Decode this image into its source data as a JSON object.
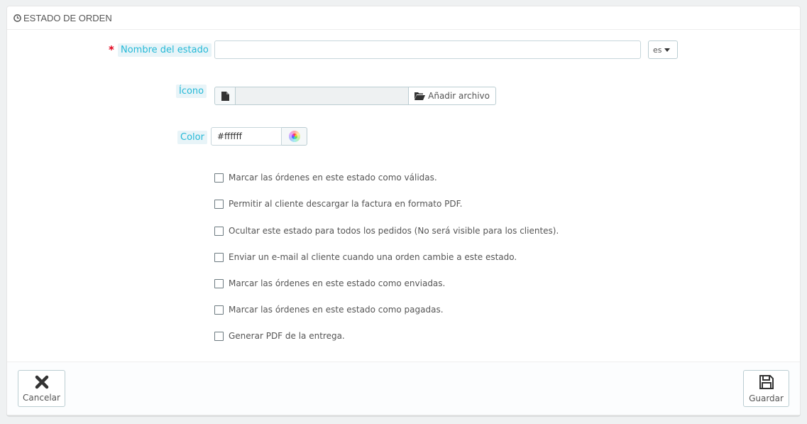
{
  "panel": {
    "title": "ESTADO DE ORDEN",
    "title_icon": "clock-icon"
  },
  "form": {
    "name_field": {
      "label": "Nombre del estado",
      "required": true,
      "value": "",
      "language": "es"
    },
    "icon_field": {
      "label": "Ícono",
      "file_icon": "file-icon",
      "button_label": "Añadir archivo",
      "button_icon": "folder-open-icon"
    },
    "color_field": {
      "label": "Color",
      "value": "#ffffff",
      "picker_icon": "color-wheel-icon"
    },
    "checkboxes": [
      {
        "label": "Marcar las órdenes en este estado como válidas.",
        "checked": false
      },
      {
        "label": "Permitir al cliente descargar la factura en formato PDF.",
        "checked": false
      },
      {
        "label": "Ocultar este estado para todos los pedidos (No será visible para los clientes).",
        "checked": false
      },
      {
        "label": "Enviar un e-mail al cliente cuando una orden cambie a este estado.",
        "checked": false
      },
      {
        "label": "Marcar las órdenes en este estado como enviadas.",
        "checked": false
      },
      {
        "label": "Marcar las órdenes en este estado como pagadas.",
        "checked": false
      },
      {
        "label": "Generar PDF de la entrega.",
        "checked": false
      }
    ]
  },
  "footer": {
    "cancel_label": "Cancelar",
    "cancel_icon": "close-icon",
    "save_label": "Guardar",
    "save_icon": "save-icon"
  },
  "colors": {
    "accent": "#25b9d7",
    "label_bg": "#e8f4f8",
    "required": "#e0001a"
  }
}
